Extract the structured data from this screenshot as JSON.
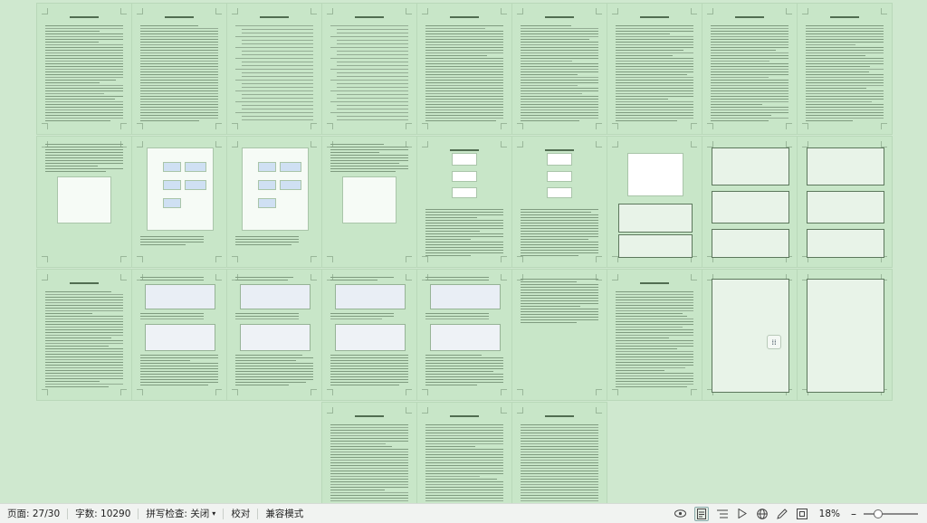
{
  "statusbar": {
    "page_label": "页面: 27/30",
    "word_count": "字数: 10290",
    "spellcheck": "拼写检查: 关闭",
    "spellcheck_arrow": "▾",
    "proofread": "校对",
    "compat_mode": "兼容模式",
    "zoom": "18%",
    "zoom_out": "–",
    "zoom_level": 0.18
  },
  "icons": [
    "eye-icon",
    "page-view-icon",
    "outline-icon",
    "play-icon",
    "globe-icon",
    "pen-icon",
    "fit-icon"
  ],
  "document": {
    "total_pages": 30,
    "current_page": 27,
    "page_tint": "#c8e6c8"
  }
}
